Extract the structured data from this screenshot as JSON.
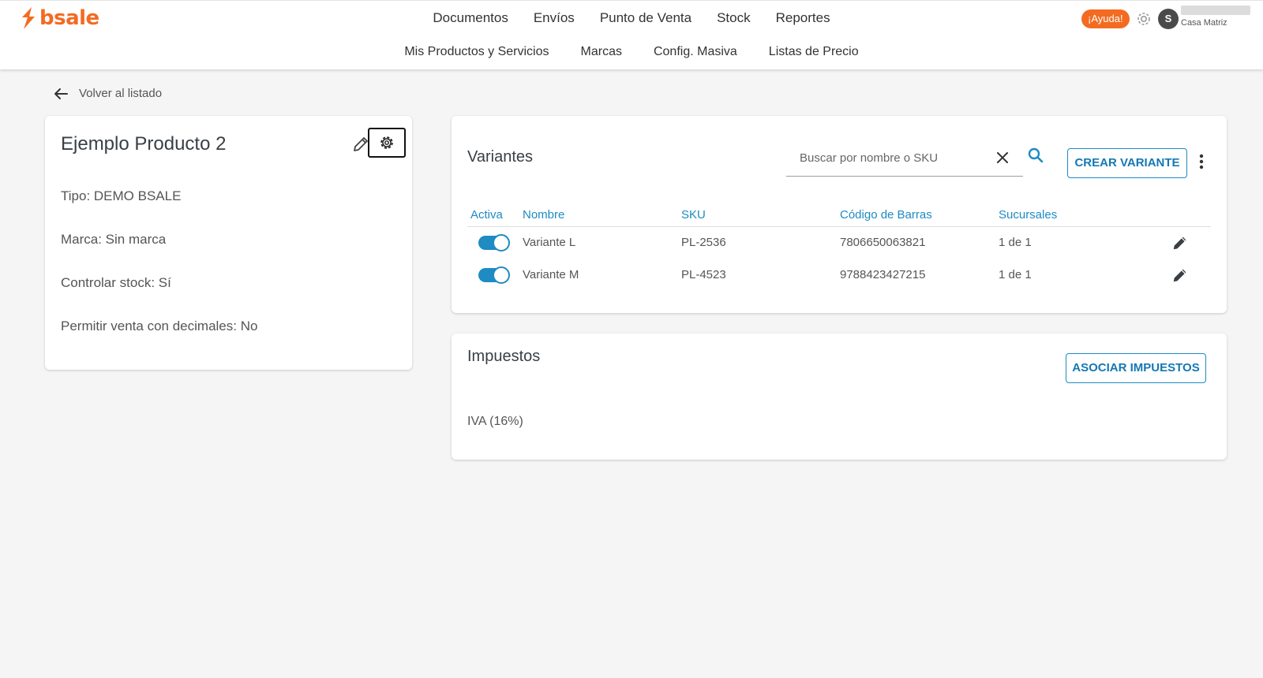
{
  "header": {
    "logo_text": "bsale",
    "brand_color": "#f36b21",
    "nav": [
      {
        "label": "Documentos"
      },
      {
        "label": "Envíos"
      },
      {
        "label": "Punto de Venta"
      },
      {
        "label": "Stock"
      },
      {
        "label": "Reportes"
      }
    ],
    "help_label": "¡Ayuda!",
    "avatar_initial": "S",
    "branch": "Casa Matriz"
  },
  "subnav": [
    {
      "label": "Mis Productos y Servicios"
    },
    {
      "label": "Marcas"
    },
    {
      "label": "Config. Masiva"
    },
    {
      "label": "Listas de Precio"
    }
  ],
  "back_label": "Volver al listado",
  "product": {
    "title": "Ejemplo Producto 2",
    "type": "Tipo: DEMO BSALE",
    "brand": "Marca: Sin marca",
    "stock_control": "Controlar stock: Sí",
    "decimal_sales": "Permitir venta con decimales: No"
  },
  "variants": {
    "title": "Variantes",
    "search_placeholder": "Buscar por nombre o SKU",
    "create_label": "CREAR VARIANTE",
    "columns": [
      "Activa",
      "Nombre",
      "SKU",
      "Código de Barras",
      "Sucursales"
    ],
    "rows": [
      {
        "active": true,
        "name": "Variante L",
        "sku": "PL-2536",
        "barcode": "7806650063821",
        "branches": "1 de 1"
      },
      {
        "active": true,
        "name": "Variante M",
        "sku": "PL-4523",
        "barcode": "9788423427215",
        "branches": "1 de 1"
      }
    ],
    "accent_color": "#1e8bc3"
  },
  "taxes": {
    "title": "Impuestos",
    "associate_label": "ASOCIAR IMPUESTOS",
    "items": [
      "IVA (16%)"
    ]
  }
}
